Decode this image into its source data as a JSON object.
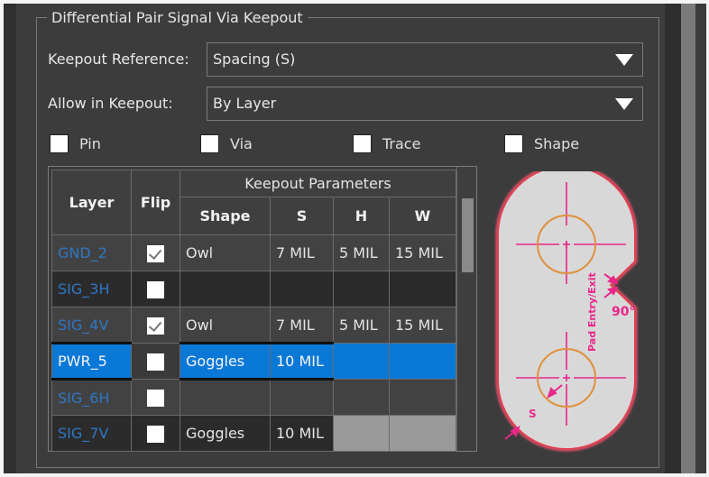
{
  "group_title": "Differential Pair Signal Via Keepout",
  "keepout_reference": {
    "label": "Keepout Reference:",
    "value": "Spacing (S)"
  },
  "allow_in_keepout": {
    "label": "Allow in Keepout:",
    "value": "By Layer"
  },
  "checkboxes": [
    {
      "label": "Pin",
      "checked": false
    },
    {
      "label": "Via",
      "checked": false
    },
    {
      "label": "Trace",
      "checked": false
    },
    {
      "label": "Shape",
      "checked": false
    }
  ],
  "grid": {
    "headers": {
      "layer": "Layer",
      "flip": "Flip",
      "group": "Keepout Parameters",
      "shape": "Shape",
      "s": "S",
      "h": "H",
      "w": "W"
    },
    "rows": [
      {
        "layer": "GND_2",
        "flip": true,
        "shape": "Owl",
        "s": "7 MIL",
        "h": "5 MIL",
        "w": "15 MIL"
      },
      {
        "layer": "SIG_3H",
        "flip": false,
        "shape": "",
        "s": "",
        "h": "",
        "w": ""
      },
      {
        "layer": "SIG_4V",
        "flip": true,
        "shape": "Owl",
        "s": "7 MIL",
        "h": "5 MIL",
        "w": "15 MIL"
      },
      {
        "layer": "PWR_5",
        "flip": false,
        "shape": "Goggles",
        "s": "10 MIL",
        "h": "",
        "w": "",
        "selected": true
      },
      {
        "layer": "SIG_6H",
        "flip": false,
        "shape": "",
        "s": "",
        "h": "",
        "w": ""
      },
      {
        "layer": "SIG_7V",
        "flip": false,
        "shape": "Goggles",
        "s": "10 MIL",
        "h": "",
        "w": ""
      }
    ]
  },
  "diagram": {
    "entry_label": "Pad Entry/Exit",
    "angle_label": "90°",
    "spacing_label": "S"
  },
  "colors": {
    "accent_selection": "#0a78d7",
    "layer_link": "#2f77c4",
    "diagram_annotation": "#e8268a",
    "diagram_pad": "#e0903c"
  }
}
